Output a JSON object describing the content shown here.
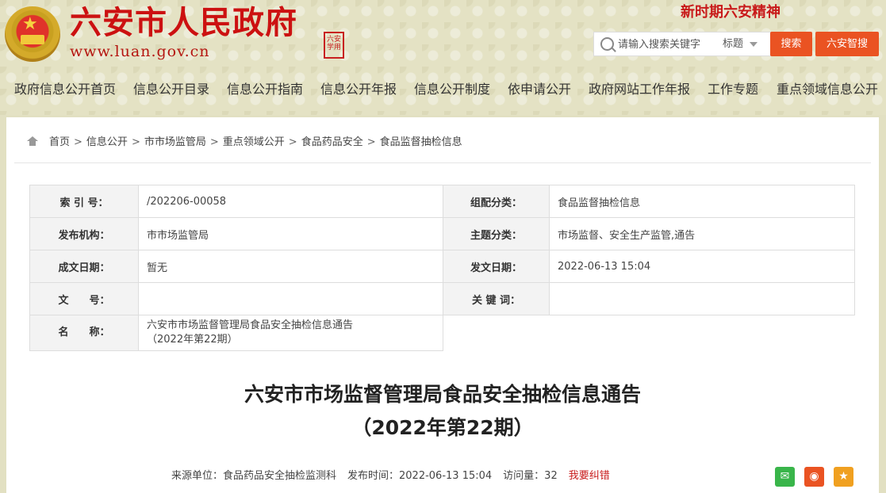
{
  "header": {
    "site_title": "六安市人民政府",
    "site_url": "www.luan.gov.cn",
    "seal_text": "六安\n学用",
    "spirit_link": "新时期六安精神",
    "search": {
      "placeholder": "请输入搜索关键字",
      "scope": "标题",
      "search_button": "搜索",
      "smart_button": "六安智搜"
    }
  },
  "nav": [
    "政府信息公开首页",
    "信息公开目录",
    "信息公开指南",
    "信息公开年报",
    "信息公开制度",
    "依申请公开",
    "政府网站工作年报",
    "工作专题",
    "重点领域信息公开"
  ],
  "breadcrumb": [
    "首页",
    "信息公开",
    "市市场监管局",
    "重点领域公开",
    "食品药品安全",
    "食品监督抽检信息"
  ],
  "meta": {
    "index_label": "索 引 号：",
    "index_value": "/202206-00058",
    "category_label": "组配分类：",
    "category_value": "食品监督抽检信息",
    "publisher_label": "发布机构：",
    "publisher_value": "市市场监管局",
    "topic_label": "主题分类：",
    "topic_value": "市场监督、安全生产监管,通告",
    "doc_date_label": "成文日期：",
    "doc_date_value": "暂无",
    "pub_date_label": "发文日期：",
    "pub_date_value": "2022-06-13 15:04",
    "doc_no_label": "文　　号：",
    "doc_no_value": "",
    "keywords_label": "关 键 词：",
    "keywords_value": "",
    "name_label": "名　　称：",
    "name_value_line1": "六安市市场监督管理局食品安全抽检信息通告",
    "name_value_line2": "（2022年第22期）"
  },
  "article": {
    "title_line1": "六安市市场监督管理局食品安全抽检信息通告",
    "title_line2": "（2022年第22期）",
    "source": "来源单位：食品药品安全抽检监测科",
    "publish_time": "发布时间：2022-06-13 15:04",
    "views": "访问量：32",
    "report_link": "我要纠错"
  }
}
